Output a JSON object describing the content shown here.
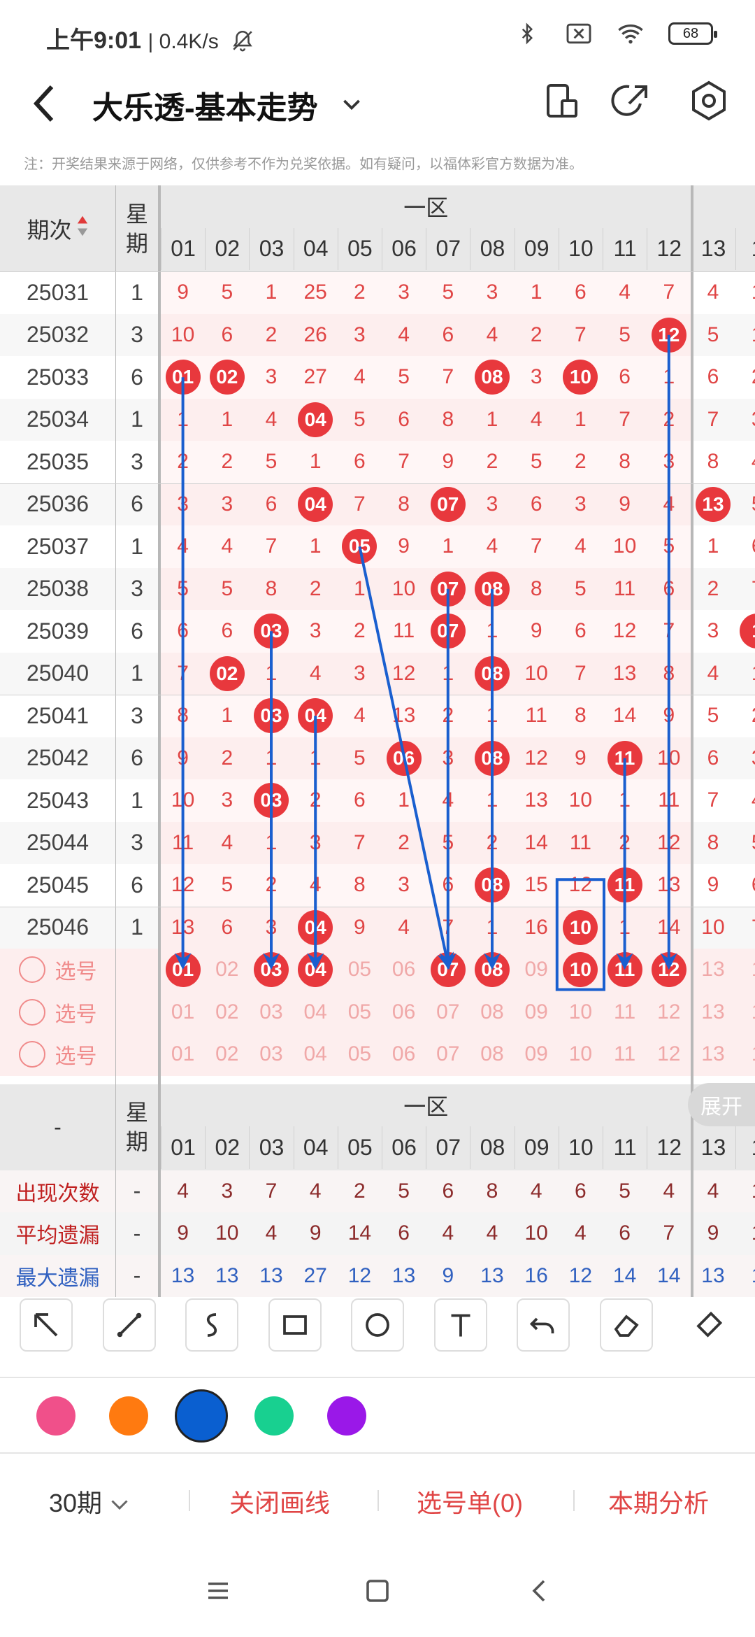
{
  "status_bar": {
    "time": "上午9:01",
    "speed": "| 0.4K/s",
    "battery": "68"
  },
  "header": {
    "title": "大乐透-基本走势",
    "icons": [
      "back-arrow-icon",
      "chevron-down-icon",
      "phone-settings-icon",
      "share-icon",
      "settings-hexagon-icon"
    ]
  },
  "notice": "注：开奖结果来源于网络，仅供参考不作为兑奖依据。如有疑问，以福体彩官方数据为准。",
  "grid": {
    "col_issue": "期次",
    "col_week": "星期",
    "zone": "一区",
    "numbers": [
      "01",
      "02",
      "03",
      "04",
      "05",
      "06",
      "07",
      "08",
      "09",
      "10",
      "11",
      "12",
      "13",
      "1"
    ],
    "rows": [
      {
        "issue": "25031",
        "week": "1",
        "cells": [
          "9",
          "5",
          "1",
          "25",
          "2",
          "3",
          "5",
          "3",
          "1",
          "6",
          "4",
          "7",
          "4",
          "1"
        ],
        "hits": []
      },
      {
        "issue": "25032",
        "week": "3",
        "cells": [
          "10",
          "6",
          "2",
          "26",
          "3",
          "4",
          "6",
          "4",
          "2",
          "7",
          "5",
          "12",
          "5",
          "1"
        ],
        "hits": [
          11
        ]
      },
      {
        "issue": "25033",
        "week": "6",
        "cells": [
          "01",
          "02",
          "3",
          "27",
          "4",
          "5",
          "7",
          "08",
          "3",
          "10",
          "6",
          "1",
          "6",
          "2"
        ],
        "hits": [
          0,
          1,
          7,
          9
        ]
      },
      {
        "issue": "25034",
        "week": "1",
        "cells": [
          "1",
          "1",
          "4",
          "04",
          "5",
          "6",
          "8",
          "1",
          "4",
          "1",
          "7",
          "2",
          "7",
          "3"
        ],
        "hits": [
          3
        ]
      },
      {
        "issue": "25035",
        "week": "3",
        "cells": [
          "2",
          "2",
          "5",
          "1",
          "6",
          "7",
          "9",
          "2",
          "5",
          "2",
          "8",
          "3",
          "8",
          "4"
        ],
        "hits": []
      },
      {
        "issue": "25036",
        "week": "6",
        "cells": [
          "3",
          "3",
          "6",
          "04",
          "7",
          "8",
          "07",
          "3",
          "6",
          "3",
          "9",
          "4",
          "13",
          "5"
        ],
        "hits": [
          3,
          6,
          12
        ]
      },
      {
        "issue": "25037",
        "week": "1",
        "cells": [
          "4",
          "4",
          "7",
          "1",
          "05",
          "9",
          "1",
          "4",
          "7",
          "4",
          "10",
          "5",
          "1",
          "6"
        ],
        "hits": [
          4
        ]
      },
      {
        "issue": "25038",
        "week": "3",
        "cells": [
          "5",
          "5",
          "8",
          "2",
          "1",
          "10",
          "07",
          "08",
          "8",
          "5",
          "11",
          "6",
          "2",
          "7"
        ],
        "hits": [
          6,
          7
        ]
      },
      {
        "issue": "25039",
        "week": "6",
        "cells": [
          "6",
          "6",
          "03",
          "3",
          "2",
          "11",
          "07",
          "1",
          "9",
          "6",
          "12",
          "7",
          "3",
          "1"
        ],
        "hits": [
          2,
          6,
          13
        ]
      },
      {
        "issue": "25040",
        "week": "1",
        "cells": [
          "7",
          "02",
          "1",
          "4",
          "3",
          "12",
          "1",
          "08",
          "10",
          "7",
          "13",
          "8",
          "4",
          "1"
        ],
        "hits": [
          1,
          7
        ]
      },
      {
        "issue": "25041",
        "week": "3",
        "cells": [
          "8",
          "1",
          "03",
          "04",
          "4",
          "13",
          "2",
          "1",
          "11",
          "8",
          "14",
          "9",
          "5",
          "2"
        ],
        "hits": [
          2,
          3
        ]
      },
      {
        "issue": "25042",
        "week": "6",
        "cells": [
          "9",
          "2",
          "1",
          "1",
          "5",
          "06",
          "3",
          "08",
          "12",
          "9",
          "11",
          "10",
          "6",
          "3"
        ],
        "hits": [
          5,
          7,
          10
        ]
      },
      {
        "issue": "25043",
        "week": "1",
        "cells": [
          "10",
          "3",
          "03",
          "2",
          "6",
          "1",
          "4",
          "1",
          "13",
          "10",
          "1",
          "11",
          "7",
          "4"
        ],
        "hits": [
          2
        ]
      },
      {
        "issue": "25044",
        "week": "3",
        "cells": [
          "11",
          "4",
          "1",
          "3",
          "7",
          "2",
          "5",
          "2",
          "14",
          "11",
          "2",
          "12",
          "8",
          "5"
        ],
        "hits": []
      },
      {
        "issue": "25045",
        "week": "6",
        "cells": [
          "12",
          "5",
          "2",
          "4",
          "8",
          "3",
          "6",
          "08",
          "15",
          "12",
          "11",
          "13",
          "9",
          "6"
        ],
        "hits": [
          7,
          10
        ]
      },
      {
        "issue": "25046",
        "week": "1",
        "cells": [
          "13",
          "6",
          "3",
          "04",
          "9",
          "4",
          "7",
          "1",
          "16",
          "10",
          "1",
          "14",
          "10",
          "7"
        ],
        "hits": [
          3,
          9
        ]
      }
    ],
    "pick_label": "选号",
    "pick_rows": [
      {
        "selected": [
          0,
          2,
          3,
          6,
          7,
          9,
          10,
          11
        ]
      },
      {
        "selected": []
      },
      {
        "selected": []
      }
    ],
    "stats_issue": "-",
    "stats": [
      {
        "label": "出现次数",
        "week": "-",
        "values": [
          "4",
          "3",
          "7",
          "4",
          "2",
          "5",
          "6",
          "8",
          "4",
          "6",
          "5",
          "4",
          "4",
          "1"
        ],
        "color": "dark"
      },
      {
        "label": "平均遗漏",
        "week": "-",
        "values": [
          "9",
          "10",
          "4",
          "9",
          "14",
          "6",
          "4",
          "4",
          "10",
          "4",
          "6",
          "7",
          "9",
          "1"
        ],
        "color": "dark"
      },
      {
        "label": "最大遗漏",
        "week": "-",
        "values": [
          "13",
          "13",
          "13",
          "27",
          "12",
          "13",
          "9",
          "13",
          "16",
          "12",
          "14",
          "14",
          "13",
          "1"
        ],
        "color": "blue"
      }
    ],
    "expand_label": "展开"
  },
  "toolbar": {
    "tools": [
      "arrow-tool-icon",
      "line-tool-icon",
      "curve-tool-icon",
      "rectangle-tool-icon",
      "circle-tool-icon",
      "text-tool-icon",
      "undo-icon",
      "eraser-icon",
      "clear-brush-icon"
    ],
    "colors": [
      "#f0508a",
      "#ff7a10",
      "#0a5fd0",
      "#18d090",
      "#9a18e8"
    ]
  },
  "actions": {
    "period": "30期",
    "close_lines": "关闭画线",
    "pick_list": "选号单(0)",
    "analysis": "本期分析"
  }
}
